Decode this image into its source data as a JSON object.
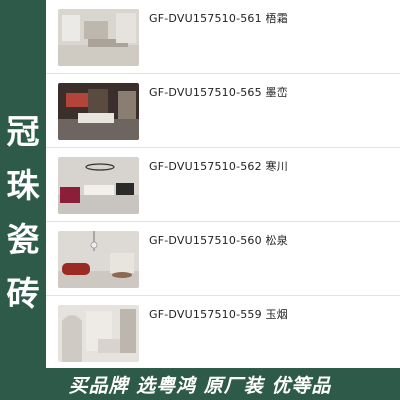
{
  "sidebar": {
    "chars": [
      "冠",
      "珠",
      "瓷",
      "砖"
    ]
  },
  "products": [
    {
      "title": "GF-DVU157510-561 梧霜"
    },
    {
      "title": "GF-DVU157510-565 墨峦"
    },
    {
      "title": "GF-DVU157510-562 寒川"
    },
    {
      "title": "GF-DVU157510-560 松泉"
    },
    {
      "title": "GF-DVU157510-559 玉烟"
    }
  ],
  "banner": {
    "text": "买品牌 选粤鸿 原厂装 优等品"
  },
  "colors": {
    "brand": "#2e5a49"
  }
}
